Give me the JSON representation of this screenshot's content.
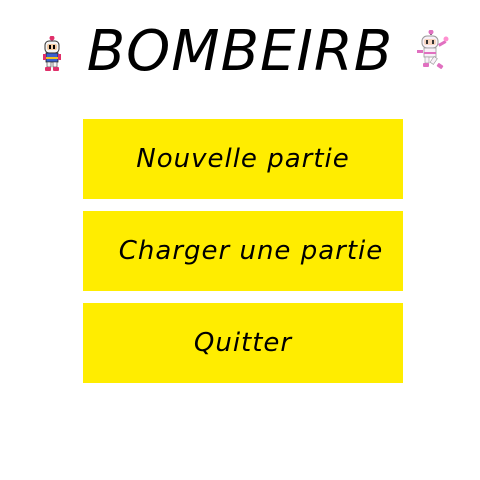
{
  "game": {
    "title": "BOMBEIRB"
  },
  "icons": {
    "left": "white-bomberman-sprite",
    "right": "pink-bomberman-sprite"
  },
  "menu": {
    "items": [
      {
        "label": "Nouvelle partie"
      },
      {
        "label": "Charger une partie"
      },
      {
        "label": "Quitter"
      }
    ]
  },
  "colors": {
    "background": "#ffffff",
    "button": "#ffed00",
    "text": "#000000"
  }
}
